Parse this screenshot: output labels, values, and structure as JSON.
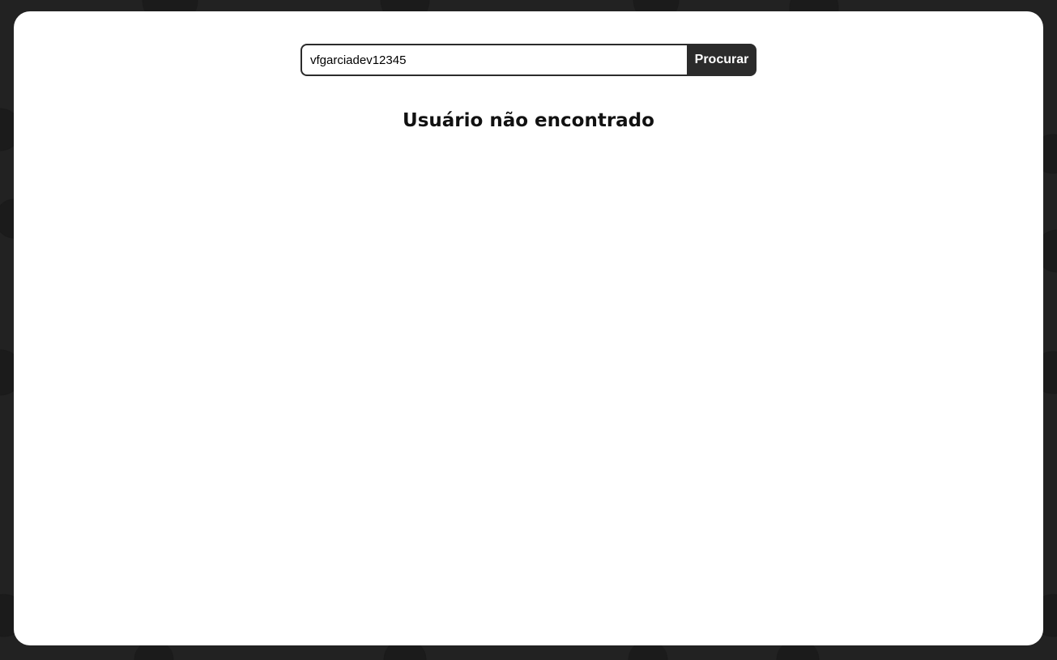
{
  "search": {
    "value": "vfgarciadev12345",
    "button_label": "Procurar"
  },
  "result": {
    "message": "Usuário não encontrado"
  },
  "background": {
    "color": "#222222",
    "pattern_icon": "octocat-icon"
  },
  "colors": {
    "card": "#ffffff",
    "button": "#2b2b2b",
    "button_text": "#ffffff"
  }
}
